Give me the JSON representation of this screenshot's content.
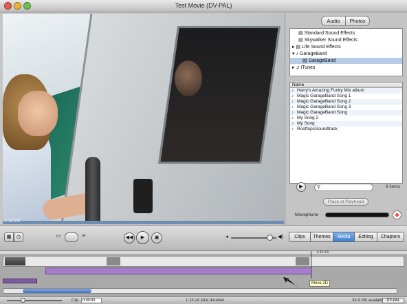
{
  "window": {
    "title": "Test Movie (DV-PAL)"
  },
  "monitor": {
    "timecode": "1:11:23",
    "scene": "Girl with microphone beside a white bus; man looking out of the bus window"
  },
  "pane": {
    "segments": [
      "Audio",
      "Photos"
    ],
    "active_segment": "Audio",
    "tree": [
      {
        "label": "Standard Sound Effects",
        "indent": 1,
        "icon": "folder-icon"
      },
      {
        "label": "Skywalker Sound Effects",
        "indent": 1,
        "icon": "folder-icon"
      },
      {
        "label": "Life Sound Effects",
        "indent": 0,
        "icon": "folder-icon"
      },
      {
        "label": "GarageBand",
        "indent": 0,
        "icon": "guitar-icon"
      },
      {
        "label": "GarageBand",
        "indent": 1,
        "icon": "folder-icon",
        "selected": true
      },
      {
        "label": "iTunes",
        "indent": 0,
        "icon": "itunes-icon"
      }
    ],
    "list_header": "Name",
    "list": [
      "Harry's Amazing Funky Mix album",
      "Magic GarageBand Song 1",
      "Magic GarageBand Song 2",
      "Magic GarageBand Song 3",
      "Magic GarageBand Song",
      "My Song 2",
      "My Song",
      "RooftopsSoundtrack"
    ],
    "search_placeholder": "",
    "item_count": "8 items",
    "place_button": "Place at Playhead",
    "mic_label": "Microphone"
  },
  "controls": {
    "project_tabs": [
      "Clips",
      "Themes",
      "Media",
      "Editing",
      "Chapters"
    ],
    "active_tab": "Media",
    "volume": 0.85
  },
  "timeline": {
    "ruler_label": "1:46:16",
    "tooltip": "Move 2D"
  },
  "status": {
    "clip_label": "Clip",
    "clip_field": "0:00:00",
    "duration": "1:15:14 total duration",
    "disk": "33.9 GB available",
    "disk_button": "DV-PAL"
  }
}
